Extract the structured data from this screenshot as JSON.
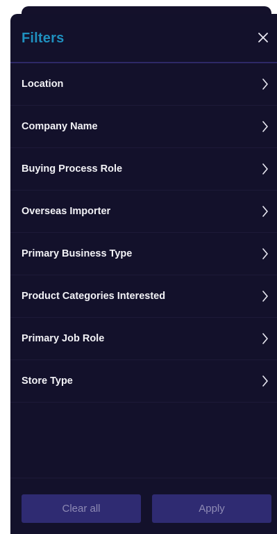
{
  "header": {
    "title": "Filters"
  },
  "filters": [
    {
      "label": "Location"
    },
    {
      "label": "Company Name"
    },
    {
      "label": "Buying Process Role"
    },
    {
      "label": "Overseas Importer"
    },
    {
      "label": "Primary Business Type"
    },
    {
      "label": "Product Categories Interested"
    },
    {
      "label": "Primary Job Role"
    },
    {
      "label": "Store Type"
    }
  ],
  "footer": {
    "clear_label": "Clear all",
    "apply_label": "Apply"
  },
  "icons": {
    "close": "close-icon",
    "chevron": "chevron-right-icon"
  },
  "colors": {
    "panel_bg": "#13112b",
    "title": "#1f90bf",
    "button_bg": "#2f2b72",
    "button_text": "#8f8bb5"
  }
}
